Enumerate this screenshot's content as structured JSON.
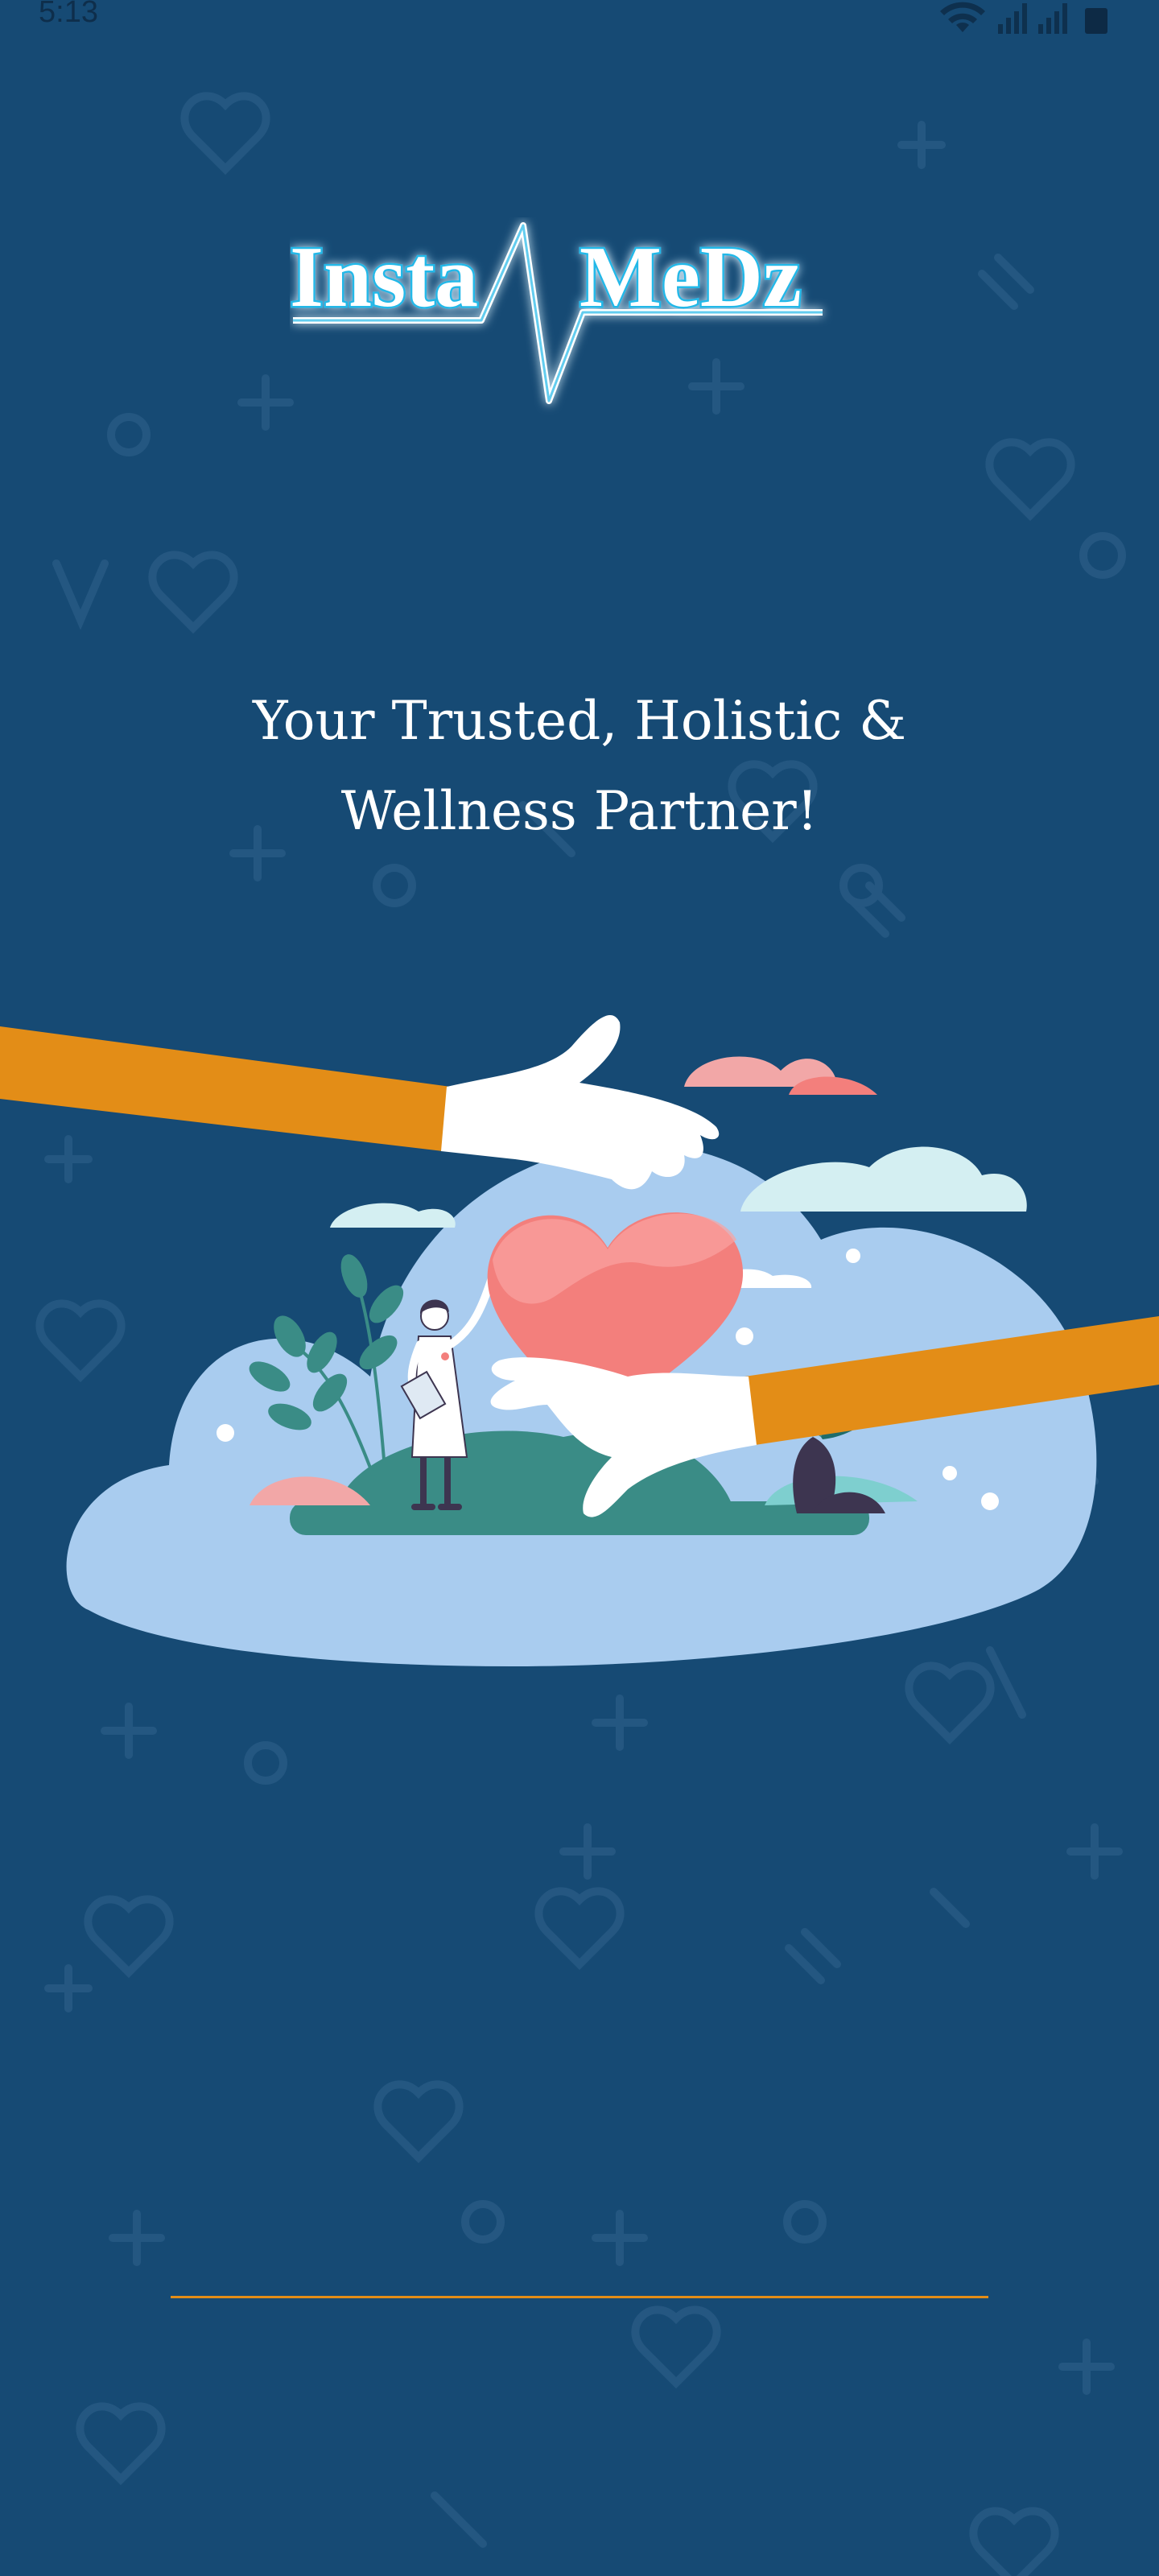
{
  "status_bar": {
    "time": "5:13",
    "icons": [
      "wifi-icon",
      "signal-icon",
      "signal-icon",
      "battery-icon"
    ]
  },
  "logo": {
    "word_left": "Insta",
    "word_right": "MeDz",
    "glow_color": "#22b8e8"
  },
  "tagline": {
    "line1": "Your Trusted, Holistic &",
    "line2": "Wellness Partner!"
  },
  "colors": {
    "background": "#164a74",
    "accent_orange": "#e38d17",
    "cloud_blue": "#a9ccef",
    "heart": "#f37f7c"
  },
  "loading": {
    "progress": 1.0
  }
}
